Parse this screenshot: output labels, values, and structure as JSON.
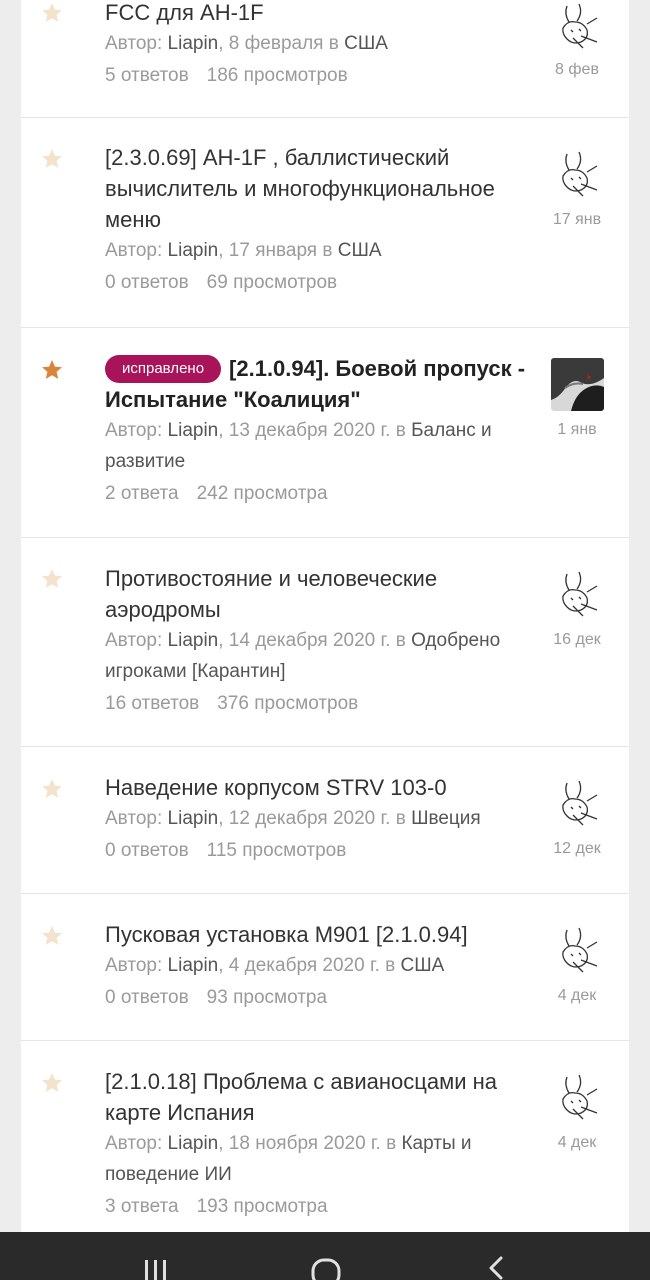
{
  "topics": [
    {
      "title": "FCC для АН-1F",
      "author_prefix": "Автор: ",
      "author": "Liapin",
      "date_text": ", 8 февраля в ",
      "category": "США",
      "replies": "5 ответов",
      "views": "186 просмотров",
      "last_date": "8 фев",
      "starred": false
    },
    {
      "title": "[2.3.0.69] АН-1F , баллистический вычислитель и многофункциональное меню",
      "author_prefix": "Автор: ",
      "author": "Liapin",
      "date_text": ", 17 января в ",
      "category": "США",
      "replies": "0 ответов",
      "views": "69 просмотров",
      "last_date": "17 янв",
      "starred": false
    },
    {
      "badge": "исправлено",
      "title": "[2.1.0.94]. Боевой пропуск - Испытание \"Коалиция\"",
      "author_prefix": "Автор: ",
      "author": "Liapin",
      "date_text": ", 13 декабря 2020 г. в ",
      "category": "Баланс и развитие",
      "replies": "2 ответа",
      "views": "242 просмотра",
      "last_date": "1 янв",
      "starred": true
    },
    {
      "title": "Противостояние и человеческие аэродромы",
      "author_prefix": "Автор: ",
      "author": "Liapin",
      "date_text": ", 14 декабря 2020 г. в ",
      "category": "Одобрено игроками [Карантин]",
      "replies": "16 ответов",
      "views": "376 просмотров",
      "last_date": "16 дек",
      "starred": false
    },
    {
      "title": "Наведение корпусом STRV 103-0",
      "author_prefix": "Автор: ",
      "author": "Liapin",
      "date_text": ", 12 декабря 2020 г. в ",
      "category": "Швеция",
      "replies": "0 ответов",
      "views": "115 просмотров",
      "last_date": "12 дек",
      "starred": false
    },
    {
      "title": "Пусковая установка М901 [2.1.0.94]",
      "author_prefix": "Автор: ",
      "author": "Liapin",
      "date_text": ", 4 декабря 2020 г. в ",
      "category": "США",
      "replies": "0 ответов",
      "views": "93 просмотра",
      "last_date": "4 дек",
      "starred": false
    },
    {
      "title": "[2.1.0.18] Проблема с авианосцами на карте Испания",
      "author_prefix": "Автор: ",
      "author": "Liapin",
      "date_text": ", 18 ноября 2020 г. в ",
      "category": "Карты и поведение ИИ",
      "replies": "3 ответа",
      "views": "193 просмотра",
      "last_date": "4 дек",
      "starred": false
    }
  ],
  "colors": {
    "star_inactive": "#f3e3cc",
    "star_active": "#d9843b",
    "badge": "#a8135a",
    "nav_bar": "#2a2a2a"
  },
  "navbar": {
    "icons": [
      "recent-apps-icon",
      "home-icon",
      "back-icon"
    ]
  }
}
